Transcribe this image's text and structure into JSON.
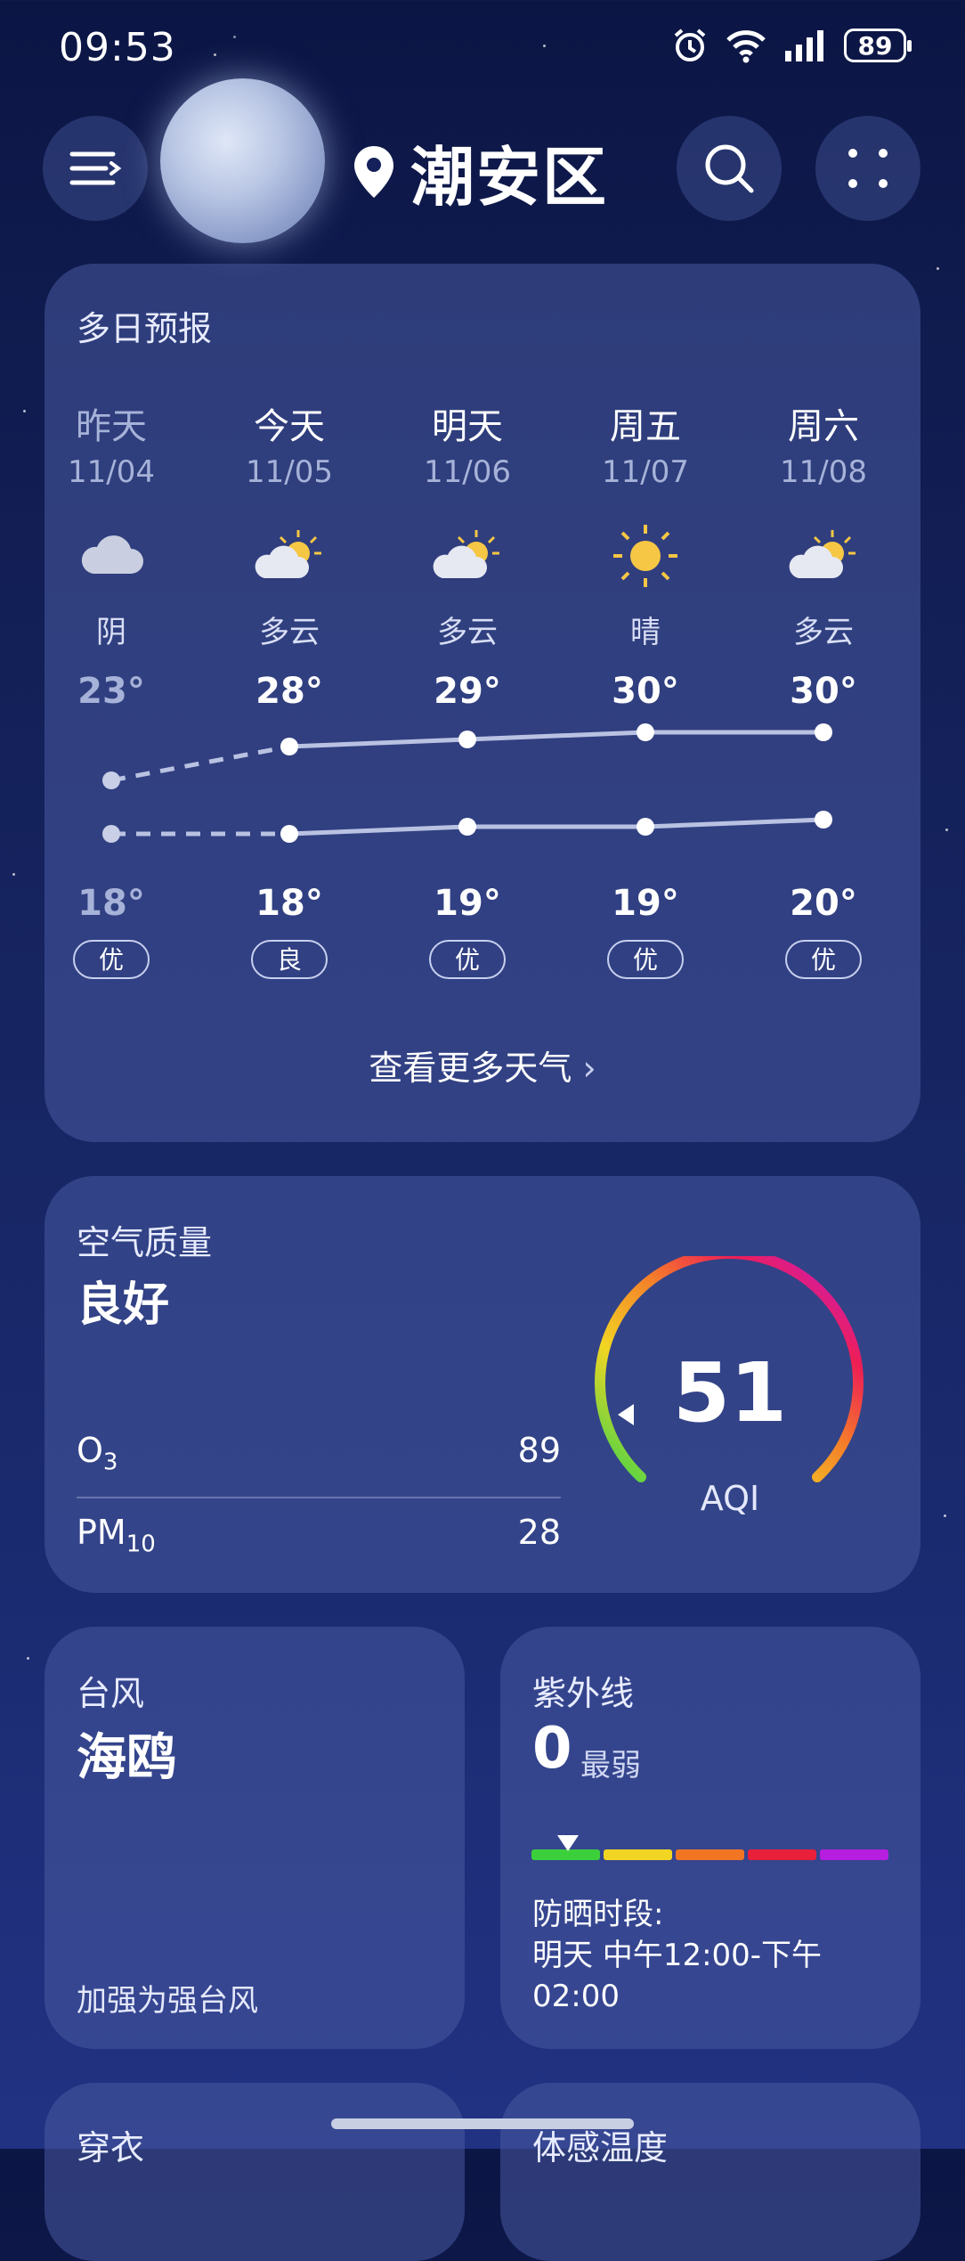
{
  "status_bar": {
    "time": "09:53",
    "battery": "89"
  },
  "header": {
    "location": "潮安区"
  },
  "forecast": {
    "title": "多日预报",
    "more_label": "查看更多天气",
    "days": [
      {
        "name": "昨天",
        "date": "11/04",
        "condition": "阴",
        "high": "23°",
        "low": "18°",
        "aqi": "优",
        "icon": "cloud-icon"
      },
      {
        "name": "今天",
        "date": "11/05",
        "condition": "多云",
        "high": "28°",
        "low": "18°",
        "aqi": "良",
        "icon": "partly-cloudy-icon"
      },
      {
        "name": "明天",
        "date": "11/06",
        "condition": "多云",
        "high": "29°",
        "low": "19°",
        "aqi": "优",
        "icon": "partly-cloudy-icon"
      },
      {
        "name": "周五",
        "date": "11/07",
        "condition": "晴",
        "high": "30°",
        "low": "19°",
        "aqi": "优",
        "icon": "sun-icon"
      },
      {
        "name": "周六",
        "date": "11/08",
        "condition": "多云",
        "high": "30°",
        "low": "20°",
        "aqi": "优",
        "icon": "partly-cloudy-icon"
      }
    ]
  },
  "air_quality": {
    "title": "空气质量",
    "level": "良好",
    "aqi_value": "51",
    "aqi_label": "AQI",
    "pollutants": [
      {
        "name": "O",
        "sub": "3",
        "value": "89"
      },
      {
        "name": "PM",
        "sub": "10",
        "value": "28"
      }
    ]
  },
  "typhoon": {
    "title": "台风",
    "name": "海鸥",
    "note": "加强为强台风"
  },
  "uv": {
    "title": "紫外线",
    "value": "0",
    "level": "最弱",
    "protect_label": "防晒时段:",
    "protect_time_line1": "明天 中午12:00-下午",
    "protect_time_line2": "02:00",
    "colors": [
      "#3ccf3c",
      "#f2d523",
      "#f27524",
      "#e8203a",
      "#b61ee0"
    ]
  },
  "bottom_cards": {
    "left_title": "穿衣",
    "right_title": "体感温度"
  },
  "colors": {
    "background": "#14215a",
    "card": "#3c4c8c"
  }
}
